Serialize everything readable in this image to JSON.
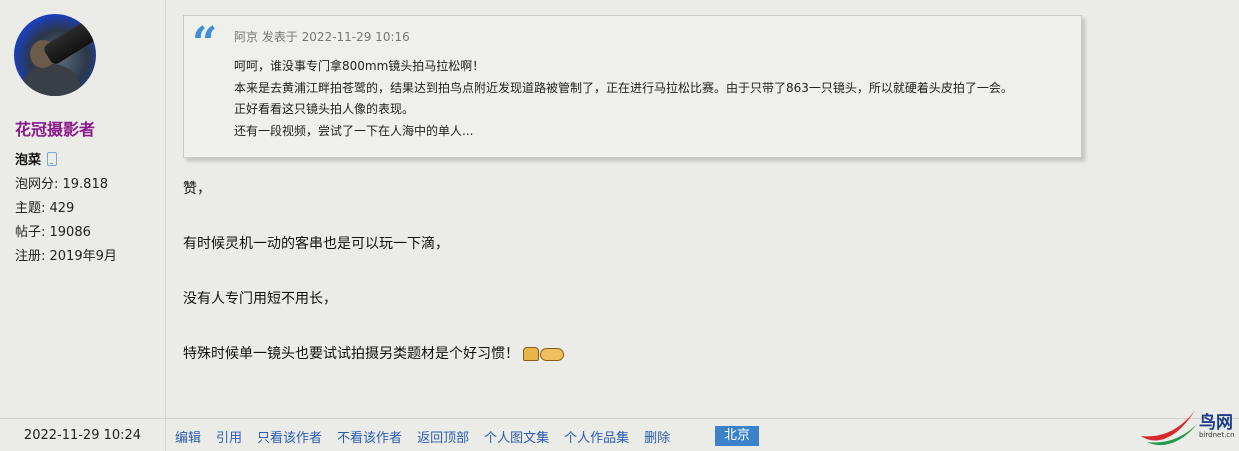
{
  "profile": {
    "username": "花冠摄影者",
    "rank": "泡菜",
    "stats": [
      "泡网分: 19.818",
      "主题: 429",
      "帖子: 19086",
      "注册: 2019年9月"
    ]
  },
  "quote": {
    "header": "阿京 发表于 2022-11-29 10:16",
    "lines": [
      "呵呵，谁没事专门拿800mm镜头拍马拉松啊！",
      "本来是去黄浦江畔拍苍鹭的，结果达到拍鸟点附近发现道路被管制了，正在进行马拉松比赛。由于只带了863一只镜头，所以就硬着头皮拍了一会。",
      "正好看看这只镜头拍人像的表现。",
      "还有一段视频，尝试了一下在人海中的单人..."
    ]
  },
  "reply": {
    "lines": [
      "赞，",
      "有时候灵机一动的客串也是可以玩一下滴，",
      "没有人专门用短不用长，",
      "特殊时候单一镜头也要试试拍摄另类题材是个好习惯！"
    ]
  },
  "footer": {
    "timestamp": "2022-11-29 10:24",
    "actions": [
      "编辑",
      "引用",
      "只看该作者",
      "不看该作者",
      "返回顶部",
      "个人图文集",
      "个人作品集",
      "删除"
    ],
    "location": "北京"
  },
  "logo": {
    "brand": "鸟网",
    "site": "birdnet.cn"
  },
  "colors": {
    "background": "#ebebe7",
    "username": "#8a1b8a",
    "link": "#2a5db0",
    "quote_mark": "#3e8ed8",
    "location_badge": "#3b82c9"
  }
}
